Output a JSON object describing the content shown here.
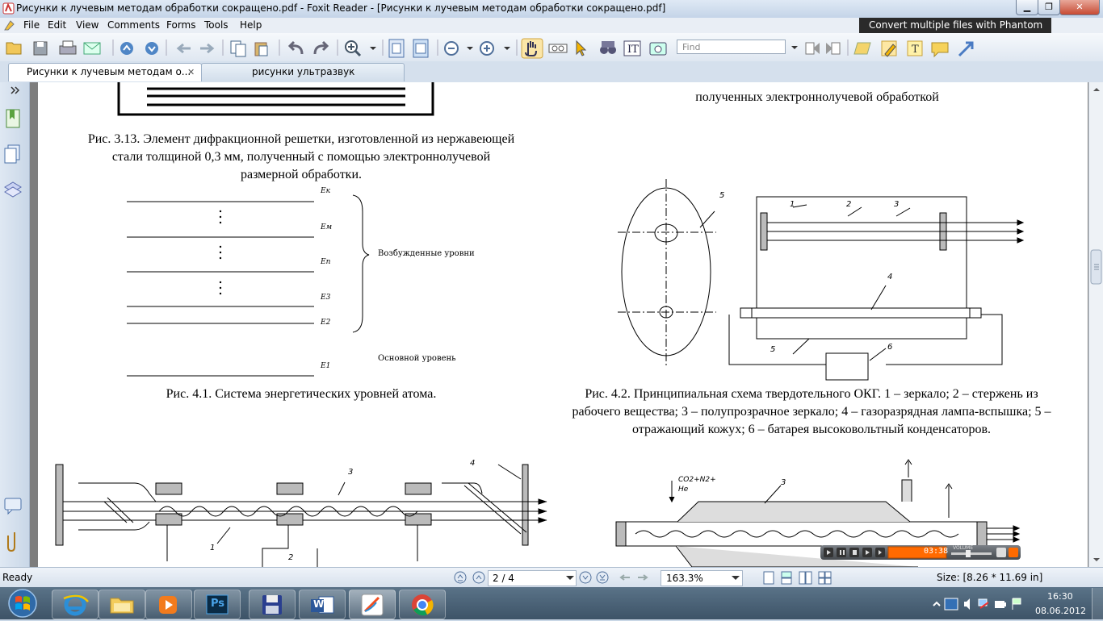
{
  "window": {
    "title": "Рисунки к лучевым методам обработки сокращено.pdf - Foxit Reader - [Рисунки к лучевым методам обработки сокращено.pdf]",
    "minimize": "▁",
    "restore": "❐",
    "close": "✕"
  },
  "menu": {
    "items": [
      "File",
      "Edit",
      "View",
      "Comments",
      "Forms",
      "Tools",
      "Help"
    ],
    "promo": "Convert multiple files with Phantom"
  },
  "toolbar": {
    "find_placeholder": "Find"
  },
  "tabs": [
    {
      "label": "Рисунки к лучевым методам о...",
      "close": "✕"
    },
    {
      "label": "рисунки ультразвук"
    }
  ],
  "document": {
    "top_right_caption": "полученных электроннолучевой обработкой",
    "fig313_caption": "Рис. 3.13. Элемент дифракционной решетки, изготовленной из нержавеющей стали толщиной 0,3 мм, полученный с помощью электроннолучевой размерной обработки.",
    "fig41": {
      "levels": [
        "Eк",
        "Eм",
        "Eп",
        "E3",
        "E2",
        "E1"
      ],
      "excited_label": "Возбужденные уровни",
      "ground_label": "Основной уровень",
      "caption": "Рис. 4.1. Система энергетических уровней атома."
    },
    "fig42": {
      "numbers": [
        "1",
        "2",
        "3",
        "4",
        "5",
        "5",
        "6"
      ],
      "caption": "Рис. 4.2. Принципиальная схема твердотельного ОКГ. 1 – зеркало; 2 – стержень из рабочего вещества; 3 – полупрозрачное зеркало; 4 – газоразрядная лампа-вспышка; 5 – отражающий кожух; 6 – батарея высоковольтный конденсаторов."
    },
    "fig_bottom_left_labels": [
      "3",
      "4",
      "1",
      "2"
    ],
    "fig_bottom_right_labels": [
      "CO2+N2+",
      "He",
      "3"
    ]
  },
  "player": {
    "time": "03:38",
    "volume_label": "VOLUME"
  },
  "status": {
    "ready": "Ready",
    "page": "2 / 4",
    "zoom": "163.3%",
    "size": "Size: [8.26 * 11.69 in]"
  },
  "taskbar": {
    "time": "16:30",
    "date": "08.06.2012",
    "ps_label": "Ps",
    "word_label": "W"
  },
  "colors": {
    "accent": "#3a6ea5",
    "player_time_bg": "#ff6a00"
  }
}
